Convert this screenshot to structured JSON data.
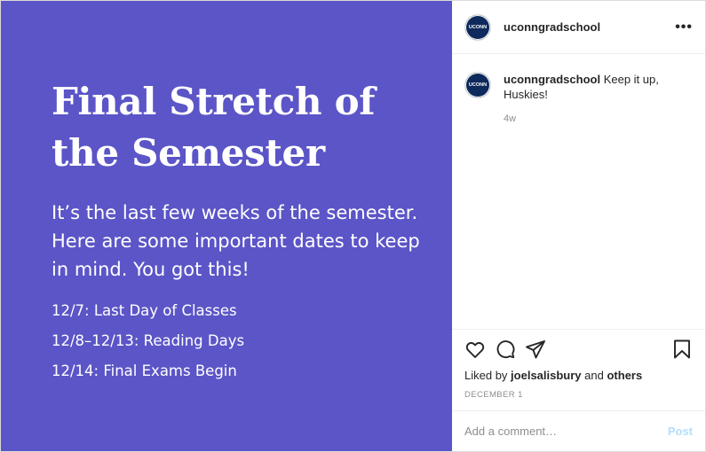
{
  "media": {
    "title": "Final Stretch of the Semester",
    "body": "It’s the last few weeks of the semester. Here are some important dates to keep in mind. You got this!",
    "dates": [
      "12/7: Last Day of Classes",
      "12/8–12/13: Reading Days",
      "12/14: Final Exams Begin"
    ],
    "background_color": "#5b55c7"
  },
  "header": {
    "avatar_text": "UCONN",
    "username": "uconngradschool",
    "more_icon": "ellipsis-icon",
    "more_label": "•••"
  },
  "comment": {
    "avatar_text": "UCONN",
    "username": "uconngradschool",
    "text": "Keep it up, Huskies!",
    "time": "4w"
  },
  "actions": {
    "icons": [
      "heart-icon",
      "comment-icon",
      "share-icon",
      "bookmark-icon"
    ],
    "liked_by_prefix": "Liked by",
    "liked_by_user": "joelsalisbury",
    "liked_by_mid": "and",
    "liked_by_others": "others",
    "date": "DECEMBER 1"
  },
  "add_comment": {
    "placeholder": "Add a comment…",
    "post_label": "Post",
    "post_color": "#b2dffc"
  }
}
